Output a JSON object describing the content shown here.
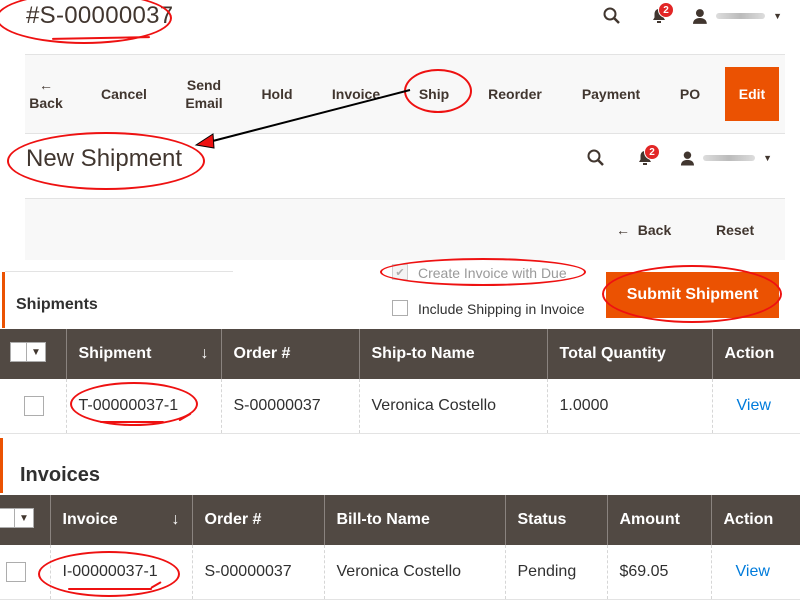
{
  "header": {
    "order_number": "#S-00000037",
    "notification_count": "2"
  },
  "actions": {
    "back": "Back",
    "cancel": "Cancel",
    "send_email": "Send Email",
    "hold": "Hold",
    "invoice": "Invoice",
    "ship": "Ship",
    "reorder": "Reorder",
    "payment": "Payment",
    "po": "PO",
    "edit": "Edit"
  },
  "shipment_page": {
    "title": "New Shipment",
    "notification_count": "2",
    "back": "Back",
    "reset": "Reset"
  },
  "options": {
    "create_invoice": "Create Invoice with Due",
    "include_shipping": "Include Shipping in Invoice",
    "submit": "Submit Shipment"
  },
  "shipments": {
    "title": "Shipments",
    "columns": [
      "Shipment",
      "Order #",
      "Ship-to Name",
      "Total Quantity",
      "Action"
    ],
    "rows": [
      {
        "id": "T-00000037-1",
        "order": "S-00000037",
        "name": "Veronica Costello",
        "qty": "1.0000",
        "action": "View"
      }
    ]
  },
  "invoices": {
    "title": "Invoices",
    "columns": [
      "Invoice",
      "Order #",
      "Bill-to Name",
      "Status",
      "Amount",
      "Action"
    ],
    "rows": [
      {
        "id": "I-00000037-1",
        "order": "S-00000037",
        "name": "Veronica Costello",
        "status": "Pending",
        "amount": "$69.05",
        "action": "View"
      }
    ]
  },
  "colors": {
    "accent": "#eb5202",
    "grid_header": "#514943",
    "link": "#007bdb",
    "annotation": "#e11"
  }
}
